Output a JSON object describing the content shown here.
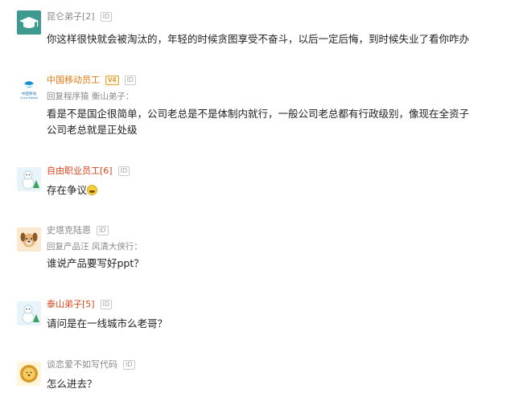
{
  "id_badge": "ID",
  "comments": [
    {
      "name": "昆仑弟子[2]",
      "name_color": "#888888",
      "avatar": "graduation-cap-avatar",
      "text": "你这样很快就会被淘汰的，年轻的时候贪图享受不奋斗，以后一定后悔，到时候失业了看你咋办"
    },
    {
      "name": "中国移动员工",
      "name_color": "#e07a10",
      "verified_badge": "V4",
      "avatar": "china-mobile-logo-avatar",
      "avatar_text_cn": "中国移动",
      "avatar_text_en": "China Mobile",
      "reply_to": "回复程序猿 衡山弟子：",
      "text_lines": [
        "看是不是国企很简单，公司老总是不是体制内就行，一般公司老总都有行政级别，像现在全资子",
        "公司老总就是正处级"
      ]
    },
    {
      "name": "自由职业员工[6]",
      "name_color": "#d9461c",
      "avatar": "snowman-avatar",
      "text": "存在争议",
      "emoji": "laughing-emoji"
    },
    {
      "name": "史塔克陆恩",
      "name_color": "#888888",
      "avatar": "dog-avatar",
      "reply_to": "回复产品汪 风清大侠行：",
      "text": "谁说产品要写好ppt？"
    },
    {
      "name": "泰山弟子[5]",
      "name_color": "#d9461c",
      "avatar": "snowman-avatar",
      "text": "请问是在一线城市么老哥？"
    },
    {
      "name": "谈恋爱不如写代码",
      "name_color": "#888888",
      "avatar": "lion-avatar",
      "text": "怎么进去？"
    }
  ]
}
